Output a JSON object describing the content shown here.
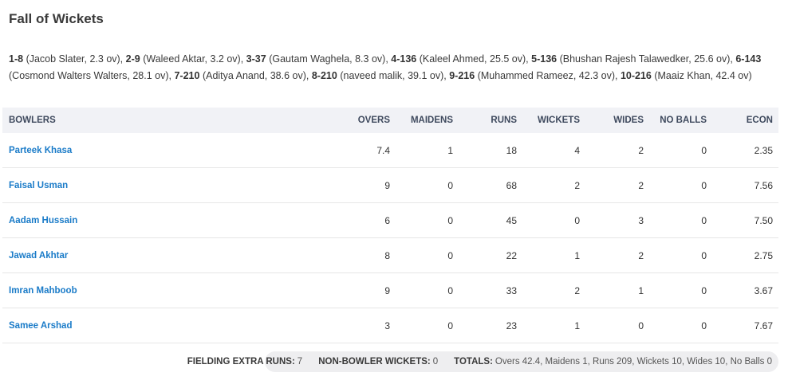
{
  "section_title": "Fall of Wickets",
  "fall_of_wickets": [
    {
      "score": "1-8",
      "detail": "(Jacob Slater, 2.3 ov),"
    },
    {
      "score": "2-9",
      "detail": "(Waleed Aktar, 3.2 ov),"
    },
    {
      "score": "3-37",
      "detail": "(Gautam Waghela, 8.3 ov),"
    },
    {
      "score": "4-136",
      "detail": "(Kaleel Ahmed, 25.5 ov),"
    },
    {
      "score": "5-136",
      "detail": "(Bhushan Rajesh Talawedker, 25.6 ov),"
    },
    {
      "score": "6-143",
      "detail": "(Cosmond Walters Walters, 28.1 ov),"
    },
    {
      "score": "7-210",
      "detail": "(Aditya Anand, 38.6 ov),"
    },
    {
      "score": "8-210",
      "detail": "(naveed malik, 39.1 ov),"
    },
    {
      "score": "9-216",
      "detail": "(Muhammed Rameez, 42.3 ov),"
    },
    {
      "score": "10-216",
      "detail": "(Maaiz Khan, 42.4 ov)"
    }
  ],
  "table": {
    "headers": {
      "bowlers": "BOWLERS",
      "overs": "OVERS",
      "maidens": "MAIDENS",
      "runs": "RUNS",
      "wickets": "WICKETS",
      "wides": "WIDES",
      "no_balls": "NO BALLS",
      "econ": "ECON"
    },
    "rows": [
      {
        "name": "Parteek Khasa",
        "overs": "7.4",
        "maidens": "1",
        "runs": "18",
        "wickets": "4",
        "wides": "2",
        "no_balls": "0",
        "econ": "2.35"
      },
      {
        "name": "Faisal Usman",
        "overs": "9",
        "maidens": "0",
        "runs": "68",
        "wickets": "2",
        "wides": "2",
        "no_balls": "0",
        "econ": "7.56"
      },
      {
        "name": "Aadam Hussain",
        "overs": "6",
        "maidens": "0",
        "runs": "45",
        "wickets": "0",
        "wides": "3",
        "no_balls": "0",
        "econ": "7.50"
      },
      {
        "name": "Jawad Akhtar",
        "overs": "8",
        "maidens": "0",
        "runs": "22",
        "wickets": "1",
        "wides": "2",
        "no_balls": "0",
        "econ": "2.75"
      },
      {
        "name": "Imran Mahboob",
        "overs": "9",
        "maidens": "0",
        "runs": "33",
        "wickets": "2",
        "wides": "1",
        "no_balls": "0",
        "econ": "3.67"
      },
      {
        "name": "Samee Arshad",
        "overs": "3",
        "maidens": "0",
        "runs": "23",
        "wickets": "1",
        "wides": "0",
        "no_balls": "0",
        "econ": "7.67"
      }
    ]
  },
  "footer": {
    "fielding_label": "FIELDING EXTRA RUNS:",
    "fielding_value": "7",
    "non_bowler_label": "NON-BOWLER WICKETS:",
    "non_bowler_value": "0",
    "totals_label": "TOTALS:",
    "totals_value": "Overs 42.4, Maidens 1, Runs 209, Wickets 10, Wides 10, No Balls 0"
  },
  "colors": {
    "link": "#1a7bc8",
    "header_bg": "#f1f2f6",
    "footer_bg": "#eeeef0"
  }
}
